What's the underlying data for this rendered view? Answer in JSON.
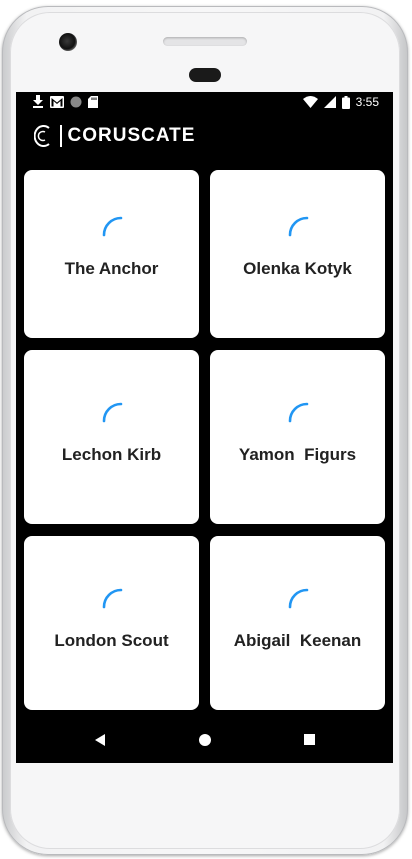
{
  "status_bar": {
    "time": "3:55",
    "left_icons": [
      "download-icon",
      "gmail-icon",
      "record-icon",
      "sd-card-icon"
    ],
    "right_icons": [
      "wifi-icon",
      "signal-icon",
      "battery-icon"
    ]
  },
  "app_bar": {
    "logo_text": "CORUSCATE",
    "logo_mark": "C"
  },
  "cards": [
    {
      "label": "The Anchor"
    },
    {
      "label": "Olenka Kotyk"
    },
    {
      "label": "Lechon Kirb"
    },
    {
      "label": "Yamon  Figurs"
    },
    {
      "label": "London Scout"
    },
    {
      "label": "Abigail  Keenan"
    }
  ],
  "nav_bar": {
    "back_icon": "back-triangle-icon",
    "home_icon": "home-circle-icon",
    "recents_icon": "recents-square-icon"
  },
  "colors": {
    "spinner": "#2196f3",
    "screen_bg": "#000000",
    "card_bg": "#ffffff",
    "label": "#222222"
  }
}
